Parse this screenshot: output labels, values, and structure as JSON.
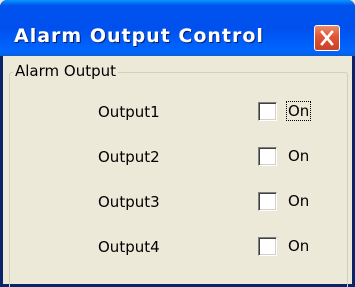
{
  "window": {
    "title": "Alarm Output Control"
  },
  "group": {
    "label": "Alarm Output"
  },
  "outputs": [
    {
      "label": "Output1",
      "checkbox_label": "On",
      "checked": false,
      "focused": true
    },
    {
      "label": "Output2",
      "checkbox_label": "On",
      "checked": false,
      "focused": false
    },
    {
      "label": "Output3",
      "checkbox_label": "On",
      "checked": false,
      "focused": false
    },
    {
      "label": "Output4",
      "checkbox_label": "On",
      "checked": false,
      "focused": false
    }
  ],
  "colors": {
    "titlebar": "#0053EE",
    "close_button": "#E2593A",
    "dialog_background": "#ECE9D8"
  }
}
